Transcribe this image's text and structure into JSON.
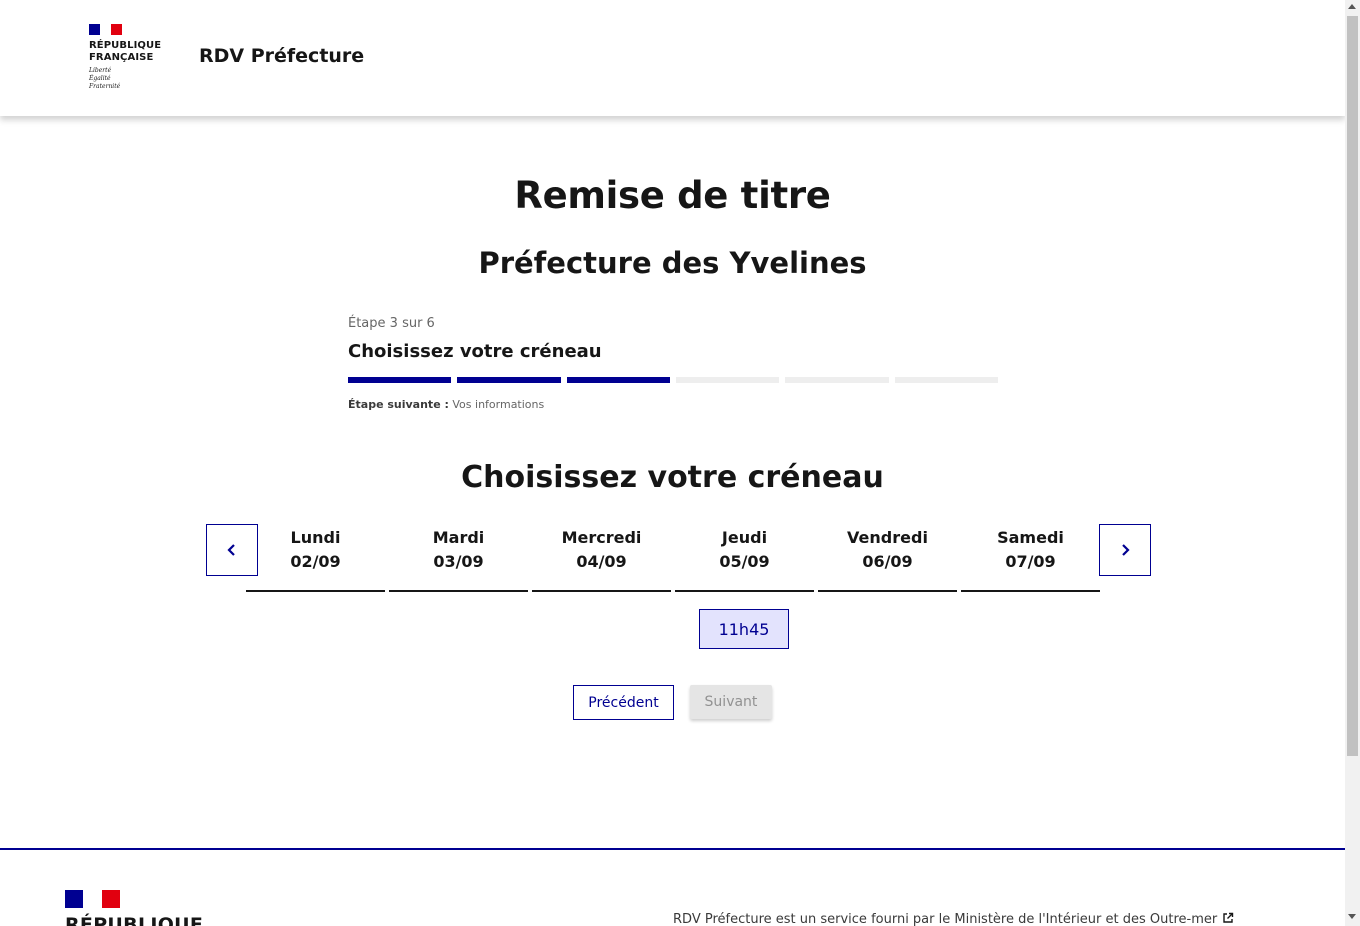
{
  "header": {
    "rf_line1": "RÉPUBLIQUE",
    "rf_line2": "FRANÇAISE",
    "motto_1": "Liberté",
    "motto_2": "Égalité",
    "motto_3": "Fraternité",
    "service_title": "RDV Préfecture"
  },
  "main": {
    "title": "Remise de titre",
    "subtitle": "Préfecture des Yvelines",
    "stepper": {
      "state": "Étape 3 sur 6",
      "current_title": "Choisissez votre créneau",
      "current_step": 3,
      "total_steps": 6,
      "next_label": "Étape suivante :",
      "next_value": "Vos informations"
    },
    "section_title": "Choisissez votre créneau",
    "calendar": {
      "prev_icon": "chevron-left-icon",
      "next_icon": "chevron-right-icon",
      "days": [
        {
          "name": "Lundi",
          "date": "02/09"
        },
        {
          "name": "Mardi",
          "date": "03/09"
        },
        {
          "name": "Mercredi",
          "date": "04/09"
        },
        {
          "name": "Jeudi",
          "date": "05/09"
        },
        {
          "name": "Vendredi",
          "date": "06/09"
        },
        {
          "name": "Samedi",
          "date": "07/09"
        }
      ],
      "slot": "11h45"
    },
    "buttons": {
      "previous": "Précédent",
      "next": "Suivant"
    }
  },
  "footer": {
    "rf_label": "RÉPUBLIQUE",
    "text": "RDV Préfecture est un service fourni par le Ministère de l'Intérieur et des Outre-mer",
    "external_icon": "external-link-icon"
  },
  "colors": {
    "primary": "#000091",
    "flag_blue": "#000091",
    "flag_red": "#e1000f",
    "slot_bg": "#e3e3fd",
    "disabled_bg": "#e5e5e5",
    "disabled_text": "#929292"
  }
}
